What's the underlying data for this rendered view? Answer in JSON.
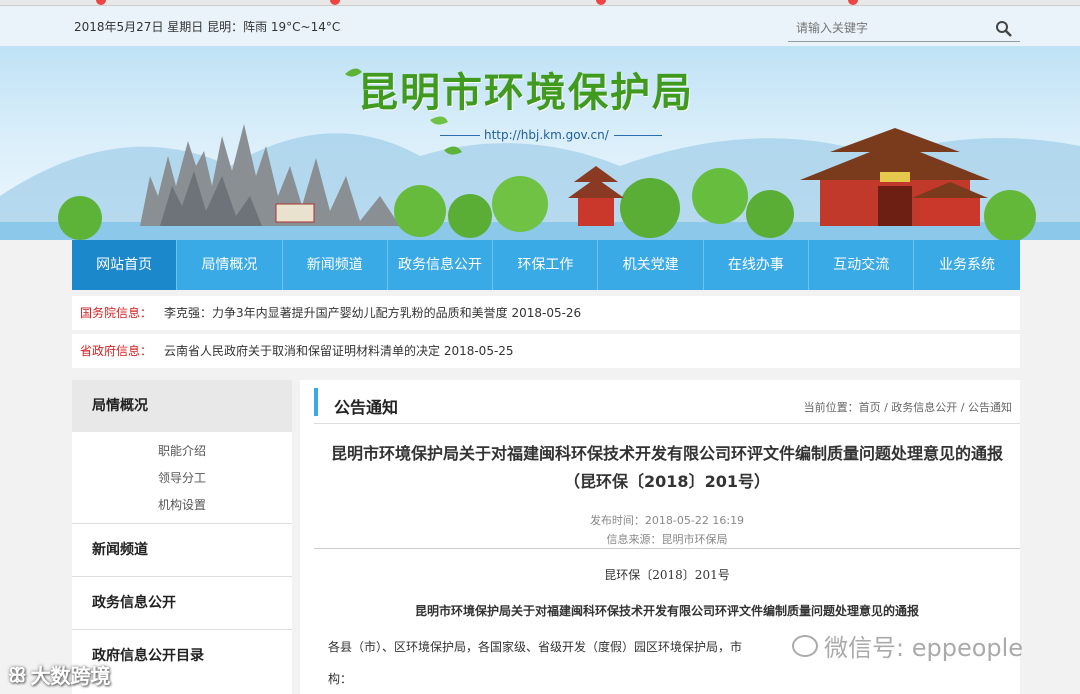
{
  "topbar": {
    "date_weather": "2018年5月27日  星期日   昆明：阵雨 19°C~14°C",
    "search_placeholder": "请输入关键字"
  },
  "banner": {
    "title": "昆明市环境保护局",
    "url": "http://hbj.km.gov.cn/"
  },
  "nav": {
    "items": [
      "网站首页",
      "局情概况",
      "新闻频道",
      "政务信息公开",
      "环保工作",
      "机关党建",
      "在线办事",
      "互动交流",
      "业务系统"
    ]
  },
  "info": [
    {
      "label": "国务院信息：",
      "text": "李克强：力争3年内显著提升国产婴幼儿配方乳粉的品质和美誉度  2018-05-26"
    },
    {
      "label": "省政府信息：",
      "text": "云南省人民政府关于取消和保留证明材料清单的决定   2018-05-25"
    }
  ],
  "sidebar": {
    "head1": "局情概况",
    "subs": [
      "职能介绍",
      "领导分工",
      "机构设置"
    ],
    "head2": "新闻频道",
    "head3": "政务信息公开",
    "head4": "政府信息公开目录"
  },
  "main": {
    "section_title": "公告通知",
    "breadcrumb": {
      "prefix": "当前位置：",
      "items": [
        "首页",
        "政务信息公开",
        "公告通知"
      ],
      "sep": " / "
    },
    "article_title": "昆明市环境保护局关于对福建闽科环保技术开发有限公司环评文件编制质量问题处理意见的通报",
    "article_subtitle": "（昆环保〔2018〕201号）",
    "publish_time": "发布时间：2018-05-22 16:19",
    "source": "信息来源：昆明市环保局",
    "doc_number": "昆环保〔2018〕201号",
    "doc_title": "昆明市环境保护局关于对福建闽科环保技术开发有限公司环评文件编制质量问题处理意见的通报",
    "body_line1": "各县（市）、区环境保护局，各国家级、省级开发（度假）园区环境保护局，市",
    "body_line2": "构："
  },
  "watermarks": {
    "wechat": "微信号: eppeople",
    "left": "大数跨境"
  },
  "colors": {
    "nav_bg": "#3aaae6",
    "nav_active": "#1c88cc",
    "title_green": "#3f9a1e",
    "label_red": "#d42020"
  }
}
